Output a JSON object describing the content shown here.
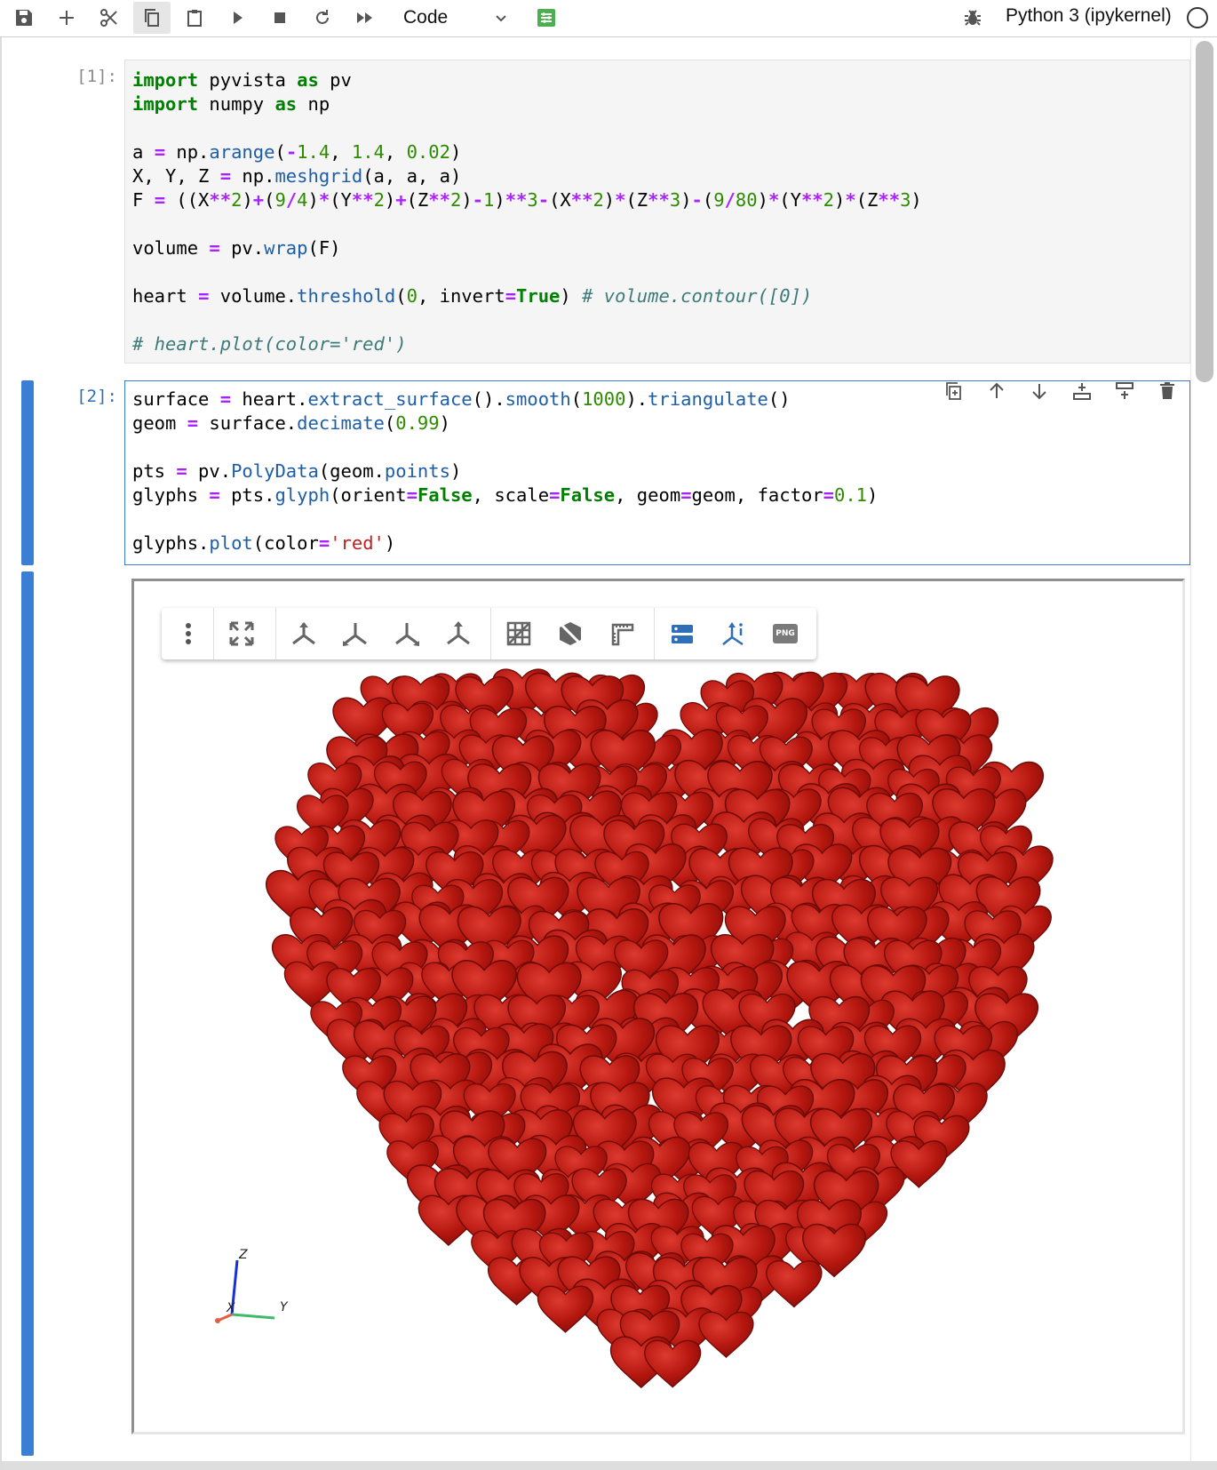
{
  "toolbar": {
    "buttons": [
      "save-icon",
      "add-cell-icon",
      "cut-icon",
      "copy-icon",
      "paste-icon",
      "run-icon",
      "stop-icon",
      "restart-icon",
      "run-all-icon"
    ],
    "cell_type": "Code",
    "settings_icon": "property-inspector-icon",
    "debugger_icon": "bug-icon",
    "kernel_name": "Python 3 (ipykernel)",
    "kernel_status_icon": "kernel-idle-circle-icon"
  },
  "cells": [
    {
      "prompt": "[1]:",
      "lines": [
        "import pyvista as pv",
        "import numpy as np",
        "",
        "a = np.arange(-1.4, 1.4, 0.02)",
        "X, Y, Z = np.meshgrid(a, a, a)",
        "F = ((X**2)+(9/4)*(Y**2)+(Z**2)-1)**3-(X**2)*(Z**3)-(9/80)*(Y**2)*(Z**3)",
        "",
        "volume = pv.wrap(F)",
        "",
        "heart = volume.threshold(0, invert=True) # volume.contour([0])",
        "",
        "# heart.plot(color='red')"
      ]
    },
    {
      "prompt": "[2]:",
      "lines": [
        "surface = heart.extract_surface().smooth(1000).triangulate()",
        "geom = surface.decimate(0.99)",
        "",
        "pts = pv.PolyData(geom.points)",
        "glyphs = pts.glyph(orient=False, scale=False, geom=geom, factor=0.1)",
        "",
        "glyphs.plot(color='red')"
      ]
    }
  ],
  "cell_toolbar": [
    "duplicate-cell-icon",
    "move-up-icon",
    "move-down-icon",
    "insert-above-icon",
    "insert-below-icon",
    "delete-cell-icon"
  ],
  "viewer": {
    "toolbar": [
      "menu-icon",
      "reset-camera-icon",
      "view-x-icon",
      "view-y-icon",
      "view-z-icon",
      "view-minus-z-icon",
      "toggle-grid-icon",
      "toggle-visibility-icon",
      "ruler-icon",
      "server-rendering-icon",
      "axes-icon",
      "screenshot-png-icon"
    ],
    "png_label": "PNG",
    "axes": {
      "z": "Z",
      "y": "Y",
      "x": "X"
    },
    "mesh_color": "#b5170f"
  }
}
